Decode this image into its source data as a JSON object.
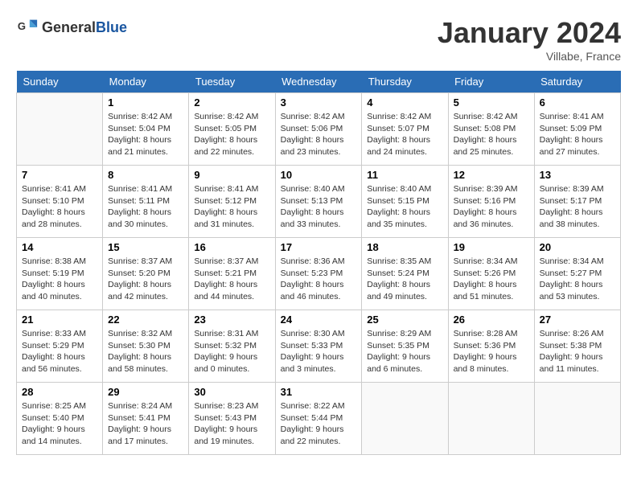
{
  "header": {
    "logo_general": "General",
    "logo_blue": "Blue",
    "month_title": "January 2024",
    "location": "Villabe, France"
  },
  "weekdays": [
    "Sunday",
    "Monday",
    "Tuesday",
    "Wednesday",
    "Thursday",
    "Friday",
    "Saturday"
  ],
  "weeks": [
    [
      {
        "day": "",
        "info": ""
      },
      {
        "day": "1",
        "info": "Sunrise: 8:42 AM\nSunset: 5:04 PM\nDaylight: 8 hours\nand 21 minutes."
      },
      {
        "day": "2",
        "info": "Sunrise: 8:42 AM\nSunset: 5:05 PM\nDaylight: 8 hours\nand 22 minutes."
      },
      {
        "day": "3",
        "info": "Sunrise: 8:42 AM\nSunset: 5:06 PM\nDaylight: 8 hours\nand 23 minutes."
      },
      {
        "day": "4",
        "info": "Sunrise: 8:42 AM\nSunset: 5:07 PM\nDaylight: 8 hours\nand 24 minutes."
      },
      {
        "day": "5",
        "info": "Sunrise: 8:42 AM\nSunset: 5:08 PM\nDaylight: 8 hours\nand 25 minutes."
      },
      {
        "day": "6",
        "info": "Sunrise: 8:41 AM\nSunset: 5:09 PM\nDaylight: 8 hours\nand 27 minutes."
      }
    ],
    [
      {
        "day": "7",
        "info": "Sunrise: 8:41 AM\nSunset: 5:10 PM\nDaylight: 8 hours\nand 28 minutes."
      },
      {
        "day": "8",
        "info": "Sunrise: 8:41 AM\nSunset: 5:11 PM\nDaylight: 8 hours\nand 30 minutes."
      },
      {
        "day": "9",
        "info": "Sunrise: 8:41 AM\nSunset: 5:12 PM\nDaylight: 8 hours\nand 31 minutes."
      },
      {
        "day": "10",
        "info": "Sunrise: 8:40 AM\nSunset: 5:13 PM\nDaylight: 8 hours\nand 33 minutes."
      },
      {
        "day": "11",
        "info": "Sunrise: 8:40 AM\nSunset: 5:15 PM\nDaylight: 8 hours\nand 35 minutes."
      },
      {
        "day": "12",
        "info": "Sunrise: 8:39 AM\nSunset: 5:16 PM\nDaylight: 8 hours\nand 36 minutes."
      },
      {
        "day": "13",
        "info": "Sunrise: 8:39 AM\nSunset: 5:17 PM\nDaylight: 8 hours\nand 38 minutes."
      }
    ],
    [
      {
        "day": "14",
        "info": "Sunrise: 8:38 AM\nSunset: 5:19 PM\nDaylight: 8 hours\nand 40 minutes."
      },
      {
        "day": "15",
        "info": "Sunrise: 8:37 AM\nSunset: 5:20 PM\nDaylight: 8 hours\nand 42 minutes."
      },
      {
        "day": "16",
        "info": "Sunrise: 8:37 AM\nSunset: 5:21 PM\nDaylight: 8 hours\nand 44 minutes."
      },
      {
        "day": "17",
        "info": "Sunrise: 8:36 AM\nSunset: 5:23 PM\nDaylight: 8 hours\nand 46 minutes."
      },
      {
        "day": "18",
        "info": "Sunrise: 8:35 AM\nSunset: 5:24 PM\nDaylight: 8 hours\nand 49 minutes."
      },
      {
        "day": "19",
        "info": "Sunrise: 8:34 AM\nSunset: 5:26 PM\nDaylight: 8 hours\nand 51 minutes."
      },
      {
        "day": "20",
        "info": "Sunrise: 8:34 AM\nSunset: 5:27 PM\nDaylight: 8 hours\nand 53 minutes."
      }
    ],
    [
      {
        "day": "21",
        "info": "Sunrise: 8:33 AM\nSunset: 5:29 PM\nDaylight: 8 hours\nand 56 minutes."
      },
      {
        "day": "22",
        "info": "Sunrise: 8:32 AM\nSunset: 5:30 PM\nDaylight: 8 hours\nand 58 minutes."
      },
      {
        "day": "23",
        "info": "Sunrise: 8:31 AM\nSunset: 5:32 PM\nDaylight: 9 hours\nand 0 minutes."
      },
      {
        "day": "24",
        "info": "Sunrise: 8:30 AM\nSunset: 5:33 PM\nDaylight: 9 hours\nand 3 minutes."
      },
      {
        "day": "25",
        "info": "Sunrise: 8:29 AM\nSunset: 5:35 PM\nDaylight: 9 hours\nand 6 minutes."
      },
      {
        "day": "26",
        "info": "Sunrise: 8:28 AM\nSunset: 5:36 PM\nDaylight: 9 hours\nand 8 minutes."
      },
      {
        "day": "27",
        "info": "Sunrise: 8:26 AM\nSunset: 5:38 PM\nDaylight: 9 hours\nand 11 minutes."
      }
    ],
    [
      {
        "day": "28",
        "info": "Sunrise: 8:25 AM\nSunset: 5:40 PM\nDaylight: 9 hours\nand 14 minutes."
      },
      {
        "day": "29",
        "info": "Sunrise: 8:24 AM\nSunset: 5:41 PM\nDaylight: 9 hours\nand 17 minutes."
      },
      {
        "day": "30",
        "info": "Sunrise: 8:23 AM\nSunset: 5:43 PM\nDaylight: 9 hours\nand 19 minutes."
      },
      {
        "day": "31",
        "info": "Sunrise: 8:22 AM\nSunset: 5:44 PM\nDaylight: 9 hours\nand 22 minutes."
      },
      {
        "day": "",
        "info": ""
      },
      {
        "day": "",
        "info": ""
      },
      {
        "day": "",
        "info": ""
      }
    ]
  ]
}
